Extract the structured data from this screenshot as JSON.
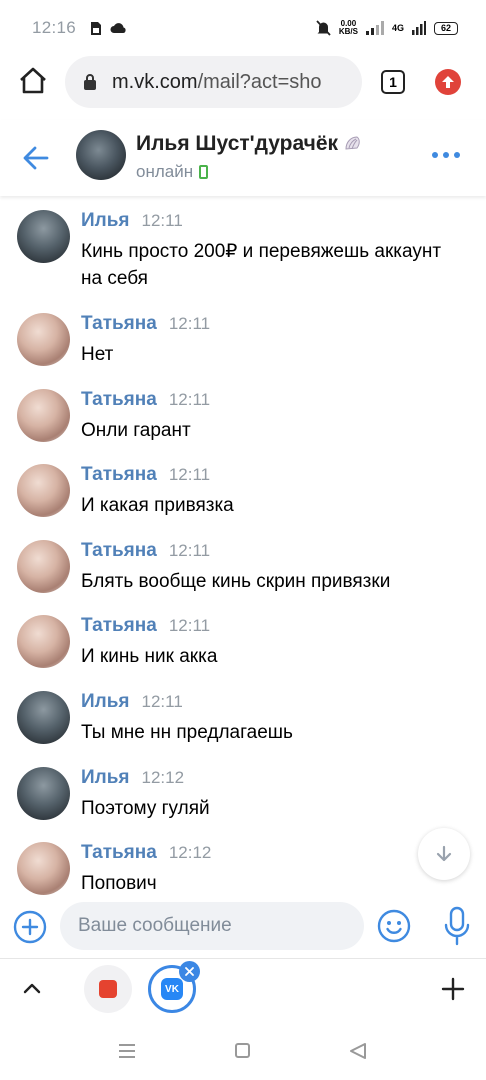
{
  "status_bar": {
    "time": "12:16",
    "speed_value": "0.00",
    "speed_unit": "KB/S",
    "network": "4G",
    "battery": "62"
  },
  "browser": {
    "url_host": "m.vk.com",
    "url_path": "/mail?act=sho",
    "tab_count": "1"
  },
  "chat": {
    "name": "Илья Шуст'дурачёк",
    "status": "онлайн"
  },
  "messages": [
    {
      "author": "Илья",
      "time": "12:11",
      "text": "Кинь просто 200₽ и перевяжешь аккаунт на себя",
      "who": "ilya"
    },
    {
      "author": "Татьяна",
      "time": "12:11",
      "text": "Нет",
      "who": "tanya"
    },
    {
      "author": "Татьяна",
      "time": "12:11",
      "text": "Онли гарант",
      "who": "tanya"
    },
    {
      "author": "Татьяна",
      "time": "12:11",
      "text": "И какая привязка",
      "who": "tanya"
    },
    {
      "author": "Татьяна",
      "time": "12:11",
      "text": "Блять вообще кинь скрин привязки",
      "who": "tanya"
    },
    {
      "author": "Татьяна",
      "time": "12:11",
      "text": "И кинь ник акка",
      "who": "tanya"
    },
    {
      "author": "Илья",
      "time": "12:11",
      "text": "Ты мне нн предлагаешь",
      "who": "ilya"
    },
    {
      "author": "Илья",
      "time": "12:12",
      "text": "Поэтому гуляй",
      "who": "ilya"
    },
    {
      "author": "Татьяна",
      "time": "12:12",
      "text": "Попович",
      "who": "tanya"
    }
  ],
  "composer": {
    "placeholder": "Ваше сообщение"
  },
  "tabbar": {
    "vk_logo": "VK"
  },
  "colors": {
    "accent": "#3f8ae0",
    "author_name": "#5181b8",
    "online": "#4bb34b"
  }
}
